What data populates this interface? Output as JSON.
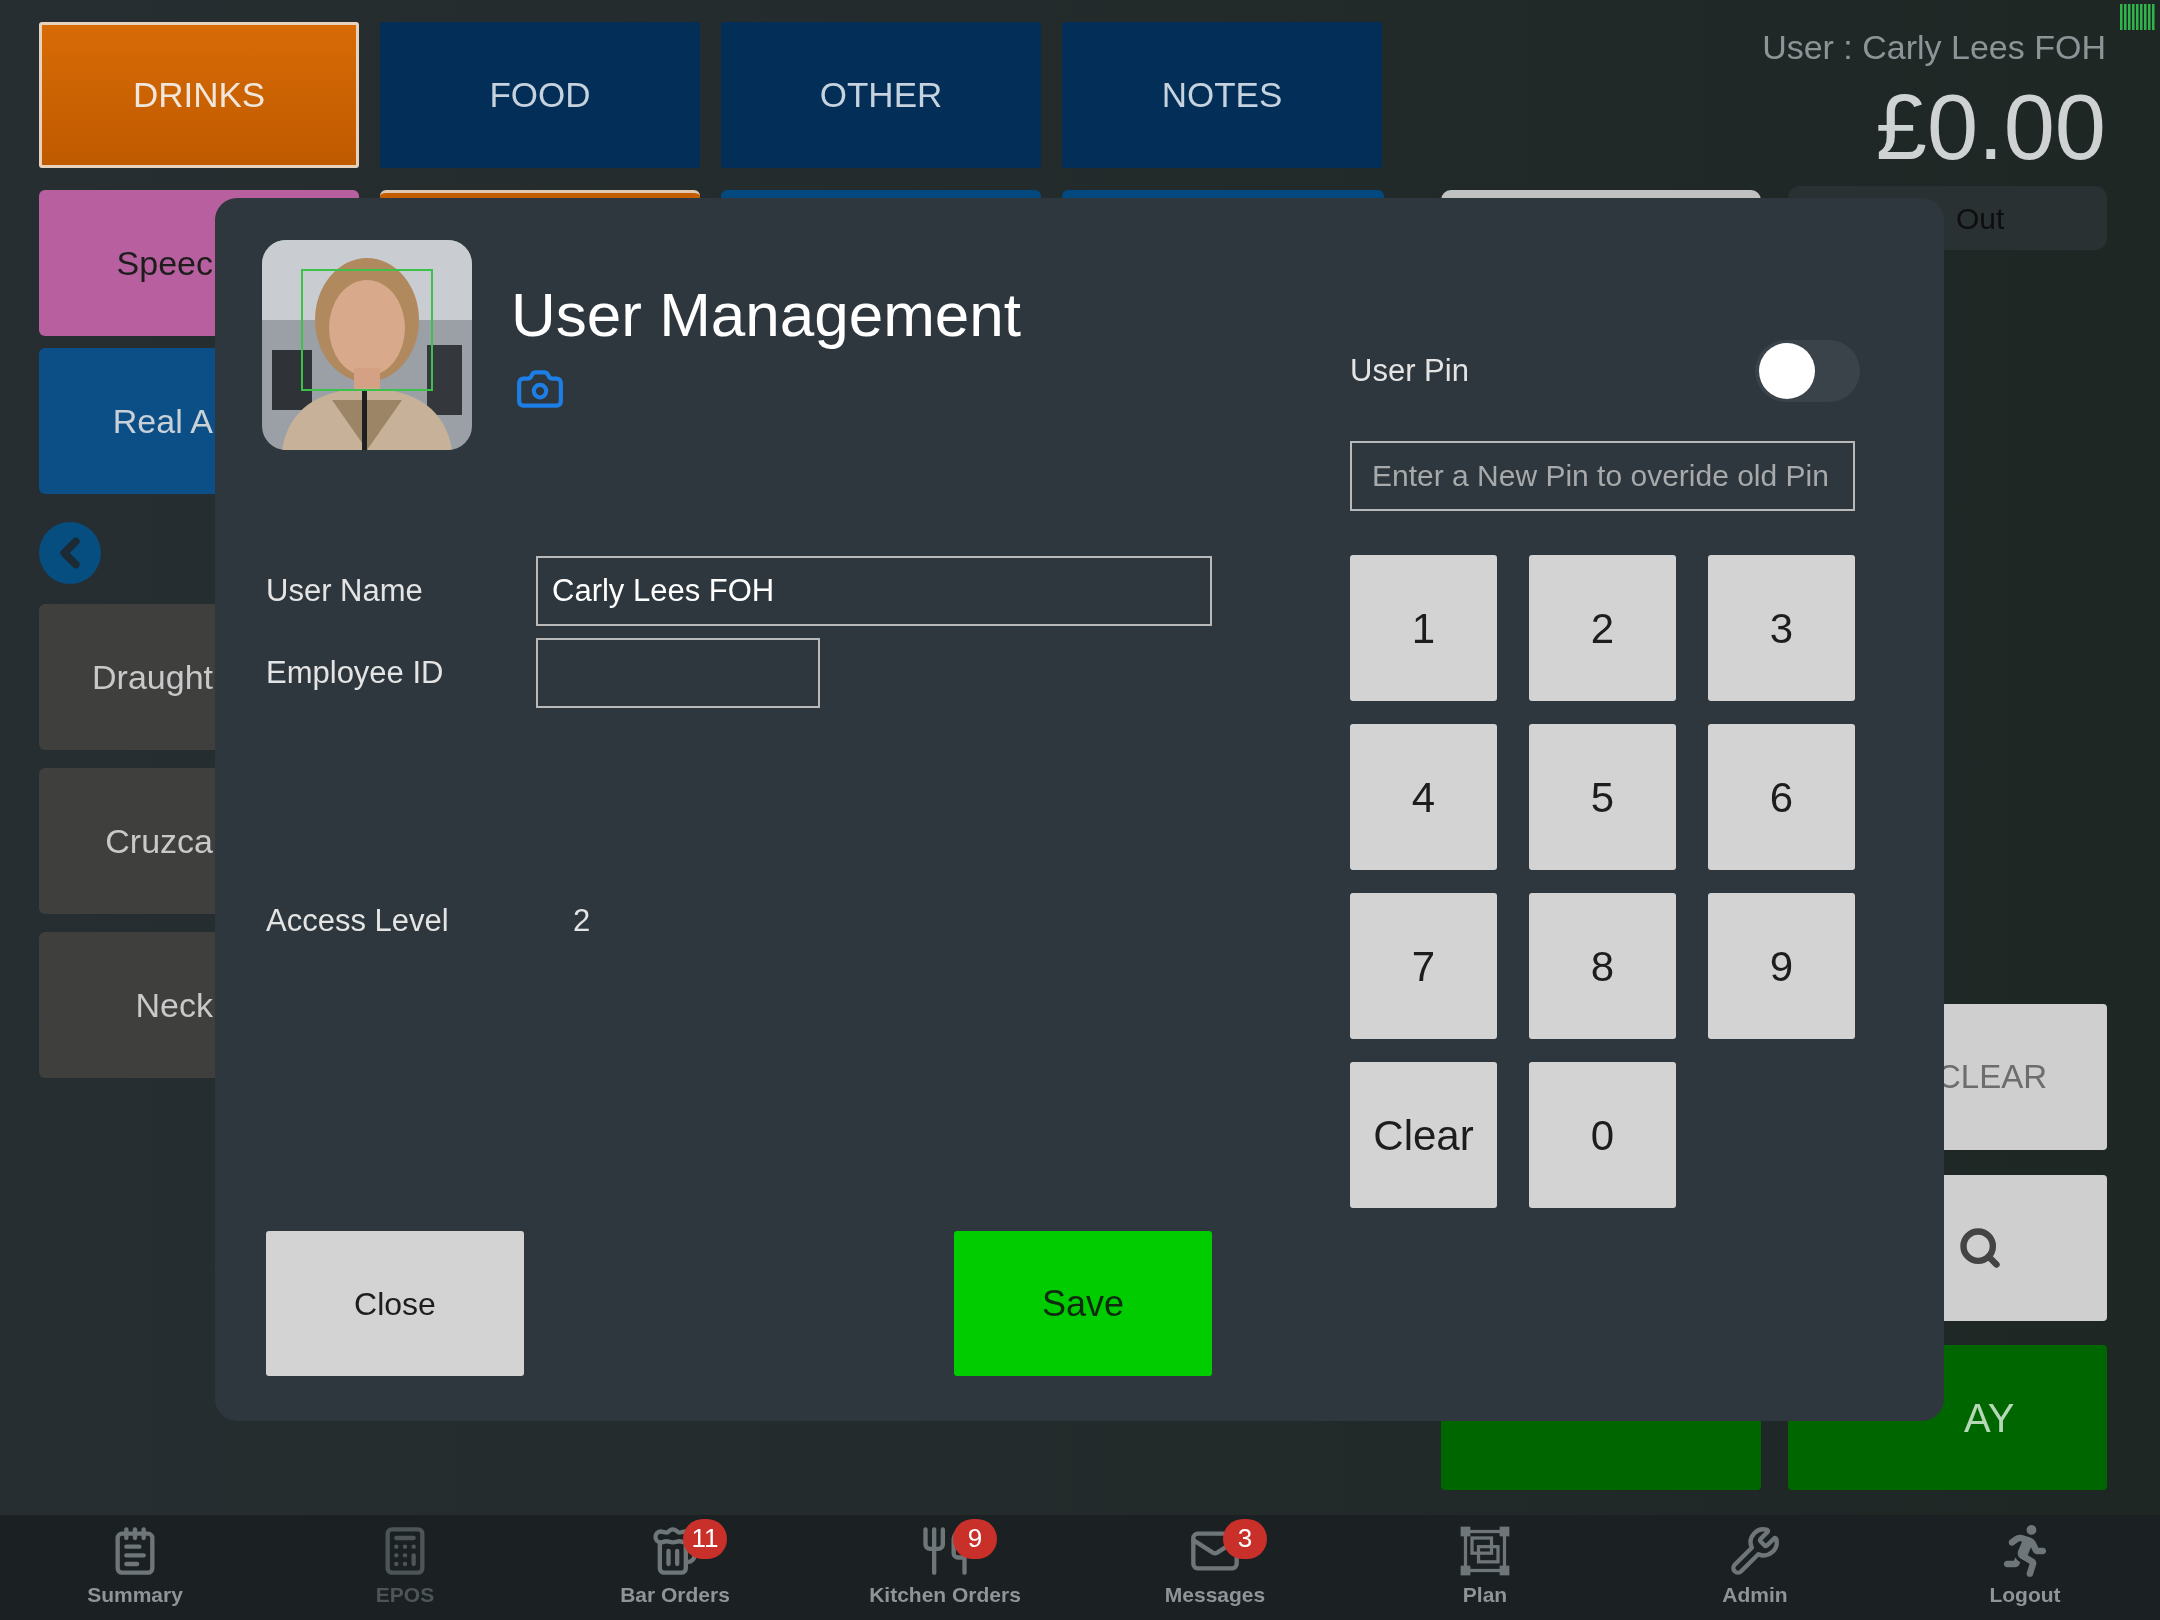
{
  "category_tabs": [
    {
      "label": "DRINKS",
      "selected": true
    },
    {
      "label": "FOOD",
      "selected": false
    },
    {
      "label": "OTHER",
      "selected": false
    },
    {
      "label": "NOTES",
      "selected": false
    }
  ],
  "header": {
    "user": "User : Carly Lees FOH",
    "total": "£0.00"
  },
  "product_tiles": [
    {
      "label": "Speec",
      "color": "#b8609f",
      "dark_text": true
    },
    {
      "label": "Real A",
      "color": "#0b4f86",
      "dark_text": false
    },
    {
      "label": "Draught",
      "color": "#3f3f3e",
      "dark_text": false
    },
    {
      "label": "Cruzca",
      "color": "#3f3f3e",
      "dark_text": false
    },
    {
      "label": "Neck",
      "color": "#3f3f3e",
      "dark_text": false
    }
  ],
  "out_bar": "Out",
  "side_buttons": {
    "clear": "CLEAR",
    "pay": "AY"
  },
  "dialog": {
    "title": "User Management",
    "fields": [
      {
        "label": "User Name",
        "value": "Carly Lees FOH"
      },
      {
        "label": "Employee ID"
      }
    ],
    "access_level": {
      "label": "Access Level",
      "value": "2"
    },
    "user_pin": {
      "label": "User Pin",
      "on": false
    },
    "pin_field": {
      "placeholder": "Enter a New Pin to overide old Pin"
    },
    "keypad": [
      "1",
      "2",
      "3",
      "4",
      "5",
      "6",
      "7",
      "8",
      "9",
      "Clear",
      "0"
    ],
    "close": "Close",
    "save": "Save"
  },
  "nav": [
    {
      "label": "Summary",
      "selected": false
    },
    {
      "label": "EPOS",
      "selected": true
    },
    {
      "label": "Bar Orders",
      "selected": false,
      "badge": "11"
    },
    {
      "label": "Kitchen Orders",
      "selected": false,
      "badge": "9"
    },
    {
      "label": "Messages",
      "selected": false,
      "badge": "3"
    },
    {
      "label": "Plan",
      "selected": false
    },
    {
      "label": "Admin",
      "selected": false
    },
    {
      "label": "Logout",
      "selected": false
    }
  ]
}
